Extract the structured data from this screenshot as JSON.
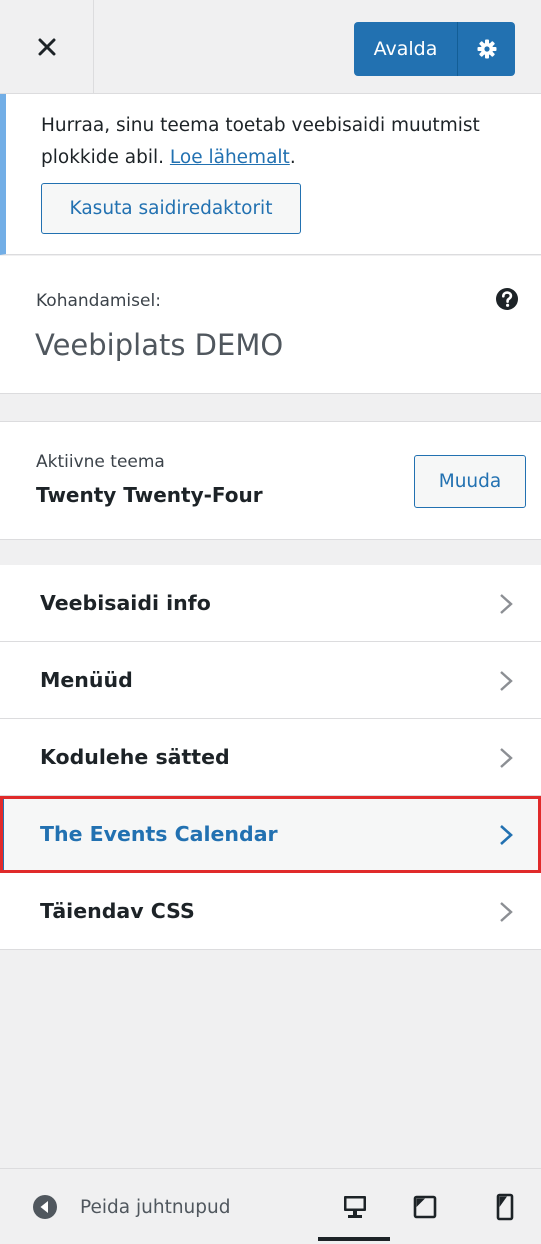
{
  "header": {
    "publish_label": "Avalda",
    "close_icon": "close-icon",
    "settings_icon": "gear-icon"
  },
  "notice": {
    "text": "Hurraa, sinu teema toetab veebisaidi muutmist plokkide abil.",
    "link": "Loe lähemalt",
    "link_suffix": ".",
    "button": "Kasuta saidiredaktorit"
  },
  "customizing": {
    "label": "Kohandamisel:",
    "title": "Veebiplats DEMO"
  },
  "theme": {
    "label": "Aktiivne teema",
    "name": "Twenty Twenty-Four",
    "change_button": "Muuda"
  },
  "menu": {
    "items": [
      {
        "label": "Veebisaidi info"
      },
      {
        "label": "Menüüd"
      },
      {
        "label": "Kodulehe sätted"
      },
      {
        "label": "The Events Calendar",
        "active": true
      },
      {
        "label": "Täiendav CSS"
      }
    ]
  },
  "footer": {
    "hide_controls": "Peida juhtnupud"
  },
  "colors": {
    "accent": "#2271b1",
    "highlight_border": "#e02a2a",
    "notice_border": "#72aee6"
  }
}
